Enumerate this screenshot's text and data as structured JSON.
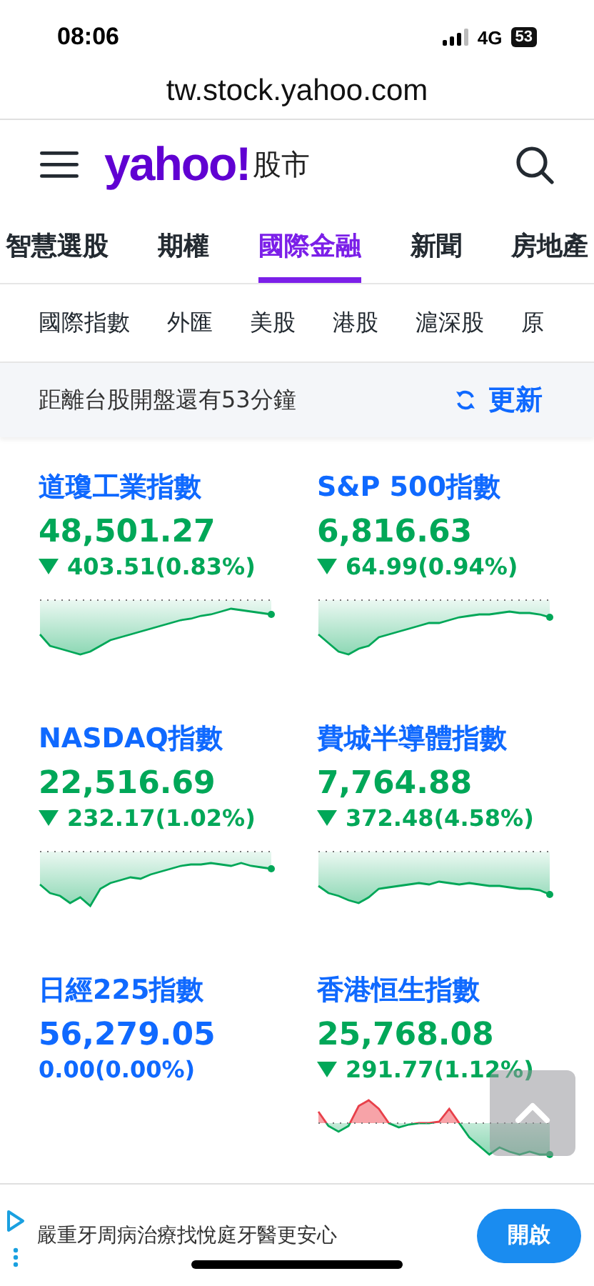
{
  "status_bar": {
    "time": "08:06",
    "network": "4G",
    "battery": "53"
  },
  "address_bar": {
    "url": "tw.stock.yahoo.com"
  },
  "header": {
    "logo": "yahoo!",
    "section": "股市"
  },
  "main_tabs": [
    {
      "label": "智慧選股",
      "selected": false
    },
    {
      "label": "期權",
      "selected": false
    },
    {
      "label": "國際金融",
      "selected": true
    },
    {
      "label": "新聞",
      "selected": false
    },
    {
      "label": "房地產",
      "selected": false
    }
  ],
  "sub_tabs": [
    {
      "label": "國際指數"
    },
    {
      "label": "外匯"
    },
    {
      "label": "美股"
    },
    {
      "label": "港股"
    },
    {
      "label": "滬深股"
    },
    {
      "label": "原"
    }
  ],
  "notice": {
    "text": "距離台股開盤還有53分鐘",
    "refresh": "更新"
  },
  "indices": [
    {
      "name": "道瓊工業指數",
      "value": "48,501.27",
      "change": "403.51(0.83%)",
      "kind": "down",
      "sparkline": true
    },
    {
      "name": "S&P 500指數",
      "value": "6,816.63",
      "change": "64.99(0.94%)",
      "kind": "down",
      "sparkline": true
    },
    {
      "name": "NASDAQ指數",
      "value": "22,516.69",
      "change": "232.17(1.02%)",
      "kind": "down",
      "sparkline": true
    },
    {
      "name": "費城半導體指數",
      "value": "7,764.88",
      "change": "372.48(4.58%)",
      "kind": "down",
      "sparkline": true
    },
    {
      "name": "日經225指數",
      "value": "56,279.05",
      "change": "0.00(0.00%)",
      "kind": "flat",
      "sparkline": false
    },
    {
      "name": "香港恒生指數",
      "value": "25,768.08",
      "change": "291.77(1.12%)",
      "kind": "down",
      "sparkline": true
    }
  ],
  "ad": {
    "text": "嚴重牙周病治療找悅庭牙醫更安心",
    "button": "開啟"
  }
}
